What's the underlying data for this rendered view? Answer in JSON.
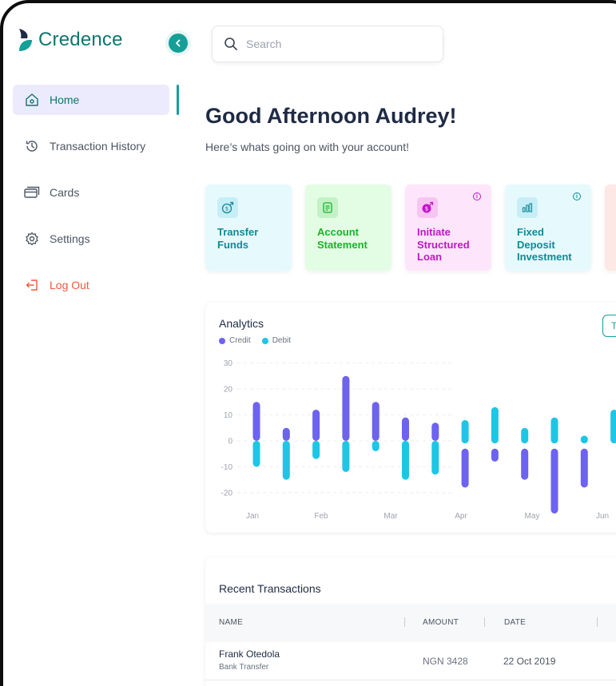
{
  "brand": {
    "name": "Credence",
    "accent": "#14a098",
    "dark": "#1f2a44"
  },
  "sidebar": {
    "collapse_icon": "chevron-left-icon",
    "items": [
      {
        "label": "Home",
        "icon": "home-icon",
        "active": true
      },
      {
        "label": "Transaction History",
        "icon": "history-icon",
        "active": false
      },
      {
        "label": "Cards",
        "icon": "cards-icon",
        "active": false
      },
      {
        "label": "Settings",
        "icon": "gear-icon",
        "active": false
      },
      {
        "label": "Log Out",
        "icon": "logout-icon",
        "active": false
      }
    ]
  },
  "search": {
    "placeholder": "Search",
    "value": ""
  },
  "header": {
    "greeting": "Good Afternoon Audrey!",
    "subtitle": "Here’s whats going on with your account!"
  },
  "quick_actions": [
    {
      "label": "Transfer Funds",
      "icon": "money-transfer-icon",
      "bg": "#e6fafe",
      "color": "#0e8a96",
      "info": false
    },
    {
      "label": "Account Statement",
      "icon": "document-icon",
      "bg": "#e3fde4",
      "color": "#17b528",
      "info": false
    },
    {
      "label": "Initiate Structured Loan",
      "icon": "loan-icon",
      "bg": "#fde6fb",
      "color": "#c217c9",
      "info": true
    },
    {
      "label": "Fixed Deposit Investment",
      "icon": "bar-chart-icon",
      "bg": "#e6fafe",
      "color": "#0e8a96",
      "info": true
    },
    {
      "label": "",
      "icon": "",
      "bg": "#fde8e6",
      "color": "#e05a3a",
      "info": false
    }
  ],
  "analytics": {
    "title": "Analytics",
    "button_label": "T",
    "legend": [
      {
        "name": "Credit",
        "color": "#6c63f0"
      },
      {
        "name": "Debit",
        "color": "#1ec6e6"
      }
    ]
  },
  "chart_data": {
    "type": "bar",
    "title": "Analytics",
    "yticks": [
      30,
      20,
      10,
      0,
      -10,
      -20
    ],
    "ylim": [
      -30,
      30
    ],
    "xticks": [
      "Jan",
      "Feb",
      "Mar",
      "Apr",
      "May",
      "Jun"
    ],
    "grid": true,
    "legend_position": "top-left",
    "series": [
      {
        "name": "Credit",
        "color": "#6c63f0",
        "bars": [
          {
            "pos": 0,
            "y0": 0,
            "y1": 15
          },
          {
            "pos": 1,
            "y0": 0,
            "y1": 5
          },
          {
            "pos": 2,
            "y0": 0,
            "y1": 12
          },
          {
            "pos": 3,
            "y0": 0,
            "y1": 25
          },
          {
            "pos": 4,
            "y0": 0,
            "y1": 15
          },
          {
            "pos": 5,
            "y0": 0,
            "y1": 9
          },
          {
            "pos": 6,
            "y0": 0,
            "y1": 7
          },
          {
            "pos": 7,
            "y0": -3,
            "y1": -18
          },
          {
            "pos": 8,
            "y0": -3,
            "y1": -8
          },
          {
            "pos": 9,
            "y0": -3,
            "y1": -15
          },
          {
            "pos": 10,
            "y0": -3,
            "y1": -28
          },
          {
            "pos": 11,
            "y0": -3,
            "y1": -18
          }
        ]
      },
      {
        "name": "Debit",
        "color": "#1ec6e6",
        "bars": [
          {
            "pos": 0,
            "y0": 0,
            "y1": -10
          },
          {
            "pos": 1,
            "y0": 0,
            "y1": -15
          },
          {
            "pos": 2,
            "y0": 0,
            "y1": -7
          },
          {
            "pos": 3,
            "y0": 0,
            "y1": -12
          },
          {
            "pos": 4,
            "y0": 0,
            "y1": -4
          },
          {
            "pos": 5,
            "y0": 0,
            "y1": -15
          },
          {
            "pos": 6,
            "y0": 0,
            "y1": -13
          },
          {
            "pos": 7,
            "y0": -1,
            "y1": 8
          },
          {
            "pos": 8,
            "y0": -1,
            "y1": 13
          },
          {
            "pos": 9,
            "y0": -1,
            "y1": 5
          },
          {
            "pos": 10,
            "y0": -1,
            "y1": 9
          },
          {
            "pos": 11,
            "y0": -1,
            "y1": 2
          },
          {
            "pos": 12,
            "y0": -1,
            "y1": 12
          }
        ]
      }
    ]
  },
  "recent": {
    "title": "Recent Transactions",
    "columns": [
      "NAME",
      "AMOUNT",
      "DATE"
    ],
    "rows": [
      {
        "name": "Frank Otedola",
        "type": "Bank Transfer",
        "amount": "NGN 3428",
        "date": "22 Oct 2019"
      }
    ]
  }
}
